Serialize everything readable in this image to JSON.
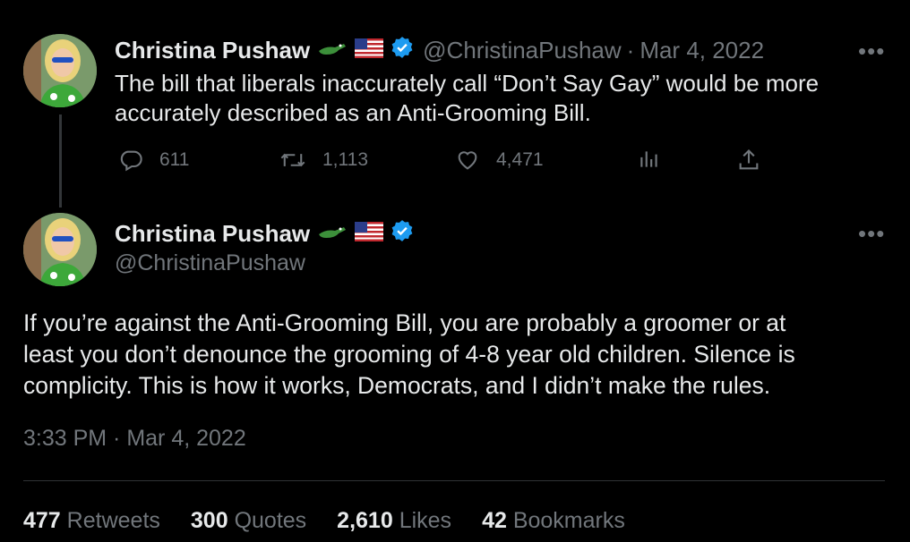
{
  "tweet1": {
    "name": "Christina Pushaw",
    "handle": "@ChristinaPushaw",
    "separator": "·",
    "date": "Mar 4, 2022",
    "text_line1": "The bill that liberals inaccurately call “Don’t Say Gay” would be more",
    "text_line2": "accurately described as an Anti-Grooming Bill.",
    "more": "•••",
    "replies": "611",
    "retweets": "1,113",
    "likes": "4,471"
  },
  "tweet2": {
    "name": "Christina Pushaw",
    "handle": "@ChristinaPushaw",
    "more": "•••",
    "text_line1": "If you’re against the Anti-Grooming Bill, you are probably a groomer or at",
    "text_line2": "least you don’t denounce the grooming of 4-8 year old children. Silence is",
    "text_line3": "complicity. This is how it works, Democrats, and I didn’t make the rules.",
    "timestamp": "3:33 PM · Mar 4, 2022"
  },
  "stats": {
    "retweets_count": "477",
    "retweets_label": "Retweets",
    "quotes_count": "300",
    "quotes_label": "Quotes",
    "likes_count": "2,610",
    "likes_label": "Likes",
    "bookmarks_count": "42",
    "bookmarks_label": "Bookmarks"
  },
  "colors": {
    "background": "#000000",
    "text": "#e7e9ea",
    "muted": "#71767b",
    "verified": "#1d9bf0",
    "divider": "#2f3336"
  },
  "icons": [
    "alligator-emoji-icon",
    "us-flag-emoji-icon",
    "verified-badge-icon",
    "reply-icon",
    "retweet-icon",
    "like-icon",
    "views-icon",
    "share-icon",
    "more-icon"
  ]
}
